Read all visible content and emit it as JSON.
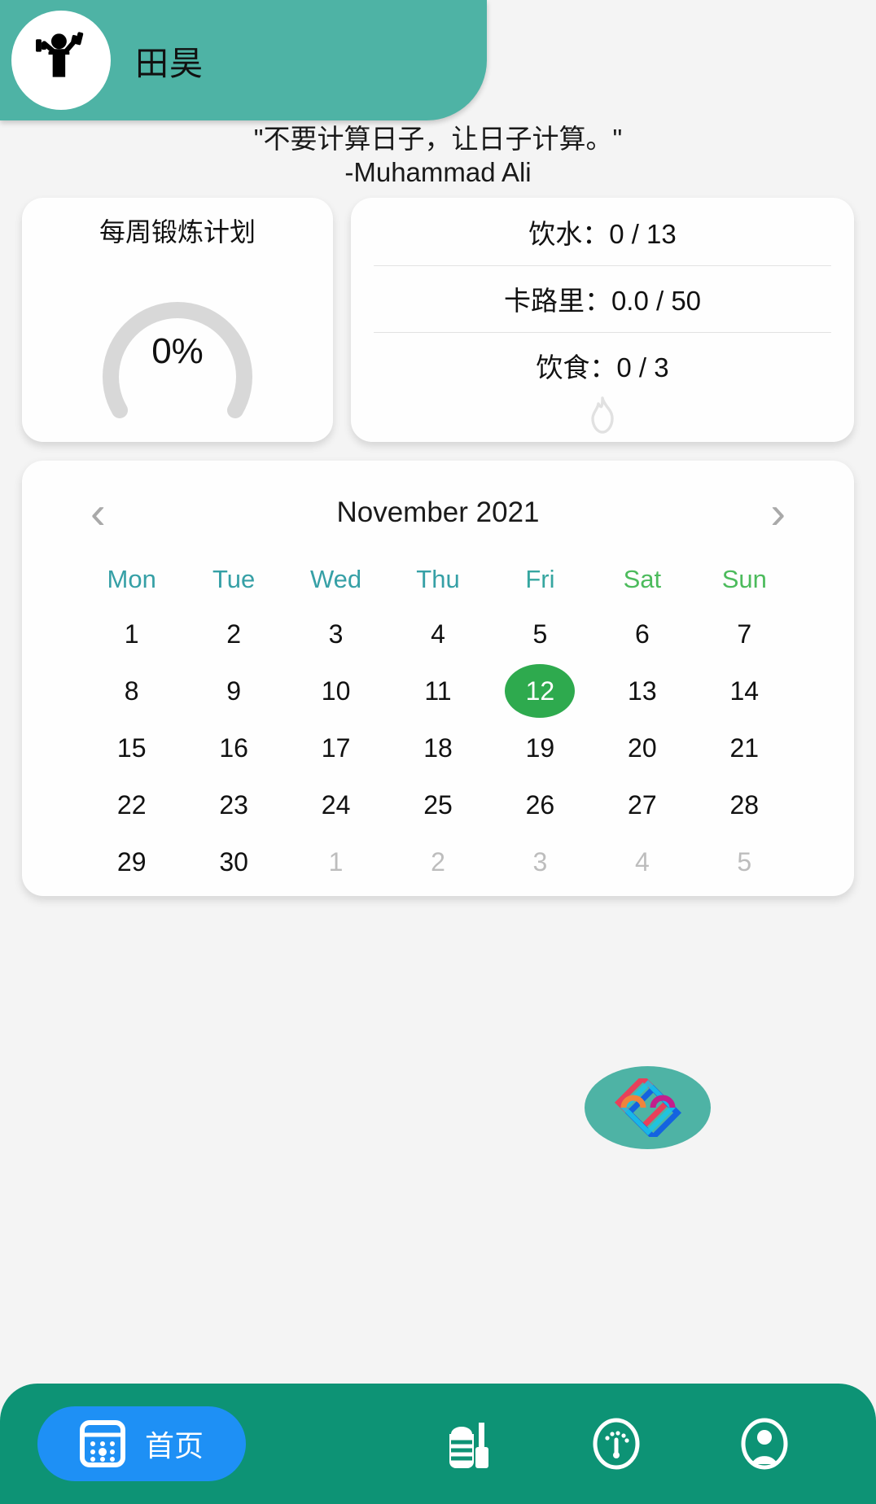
{
  "header": {
    "user_name": "田昊",
    "avatar_icon": "weightlifter-icon",
    "background_color": "#4eb3a5"
  },
  "quote": {
    "text": "\"不要计算日子，让日子计算。\"",
    "author": "-Muhammad Ali"
  },
  "plan_card": {
    "title": "每周锻炼计划",
    "percent_label": "0%",
    "percent_value": 0,
    "track_color": "#d8d8d8"
  },
  "stats_card": {
    "water": {
      "label": "饮水：0 / 13",
      "current": 0,
      "goal": 13,
      "progress": 0
    },
    "calories": {
      "label": "卡路里：0.0 / 50",
      "current": 0.0,
      "goal": 50,
      "progress": 0
    },
    "diet": {
      "label": "饮食：0 / 3",
      "current": 0,
      "goal": 3
    },
    "flame_icon": "flame-icon"
  },
  "calendar": {
    "prev_label": "‹",
    "next_label": "›",
    "title": "November 2021",
    "month": "November",
    "year": "2021",
    "weekdays": [
      {
        "label": "Mon",
        "color": "#36a0a6"
      },
      {
        "label": "Tue",
        "color": "#36a0a6"
      },
      {
        "label": "Wed",
        "color": "#36a0a6"
      },
      {
        "label": "Thu",
        "color": "#36a0a6"
      },
      {
        "label": "Fri",
        "color": "#36a6a0"
      },
      {
        "label": "Sat",
        "color": "#4cbb5c"
      },
      {
        "label": "Sun",
        "color": "#4cbb5c"
      }
    ],
    "selected_day": 12,
    "selected_color": "#2eaa4e",
    "weeks": [
      [
        {
          "day": "1",
          "muted": false,
          "selected": false
        },
        {
          "day": "2",
          "muted": false,
          "selected": false
        },
        {
          "day": "3",
          "muted": false,
          "selected": false
        },
        {
          "day": "4",
          "muted": false,
          "selected": false
        },
        {
          "day": "5",
          "muted": false,
          "selected": false
        },
        {
          "day": "6",
          "muted": false,
          "selected": false
        },
        {
          "day": "7",
          "muted": false,
          "selected": false
        }
      ],
      [
        {
          "day": "8",
          "muted": false,
          "selected": false
        },
        {
          "day": "9",
          "muted": false,
          "selected": false
        },
        {
          "day": "10",
          "muted": false,
          "selected": false
        },
        {
          "day": "11",
          "muted": false,
          "selected": false
        },
        {
          "day": "12",
          "muted": false,
          "selected": true
        },
        {
          "day": "13",
          "muted": false,
          "selected": false
        },
        {
          "day": "14",
          "muted": false,
          "selected": false
        }
      ],
      [
        {
          "day": "15",
          "muted": false,
          "selected": false
        },
        {
          "day": "16",
          "muted": false,
          "selected": false
        },
        {
          "day": "17",
          "muted": false,
          "selected": false
        },
        {
          "day": "18",
          "muted": false,
          "selected": false
        },
        {
          "day": "19",
          "muted": false,
          "selected": false
        },
        {
          "day": "20",
          "muted": false,
          "selected": false
        },
        {
          "day": "21",
          "muted": false,
          "selected": false
        }
      ],
      [
        {
          "day": "22",
          "muted": false,
          "selected": false
        },
        {
          "day": "23",
          "muted": false,
          "selected": false
        },
        {
          "day": "24",
          "muted": false,
          "selected": false
        },
        {
          "day": "25",
          "muted": false,
          "selected": false
        },
        {
          "day": "26",
          "muted": false,
          "selected": false
        },
        {
          "day": "27",
          "muted": false,
          "selected": false
        },
        {
          "day": "28",
          "muted": false,
          "selected": false
        }
      ],
      [
        {
          "day": "29",
          "muted": false,
          "selected": false
        },
        {
          "day": "30",
          "muted": false,
          "selected": false
        },
        {
          "day": "1",
          "muted": true,
          "selected": false
        },
        {
          "day": "2",
          "muted": true,
          "selected": false
        },
        {
          "day": "3",
          "muted": true,
          "selected": false
        },
        {
          "day": "4",
          "muted": true,
          "selected": false
        },
        {
          "day": "5",
          "muted": true,
          "selected": false
        }
      ]
    ]
  },
  "fab": {
    "icon": "app-logo-icon",
    "background_color": "#4eb3a5"
  },
  "bottom_nav": {
    "background_color": "#0d9375",
    "active_color": "#1e90f5",
    "items": [
      {
        "label": "首页",
        "icon": "calendar-home-icon",
        "active": true
      },
      {
        "label": "",
        "icon": "food-drink-icon",
        "active": false
      },
      {
        "label": "",
        "icon": "gauge-icon",
        "active": false
      },
      {
        "label": "",
        "icon": "profile-icon",
        "active": false
      }
    ]
  }
}
